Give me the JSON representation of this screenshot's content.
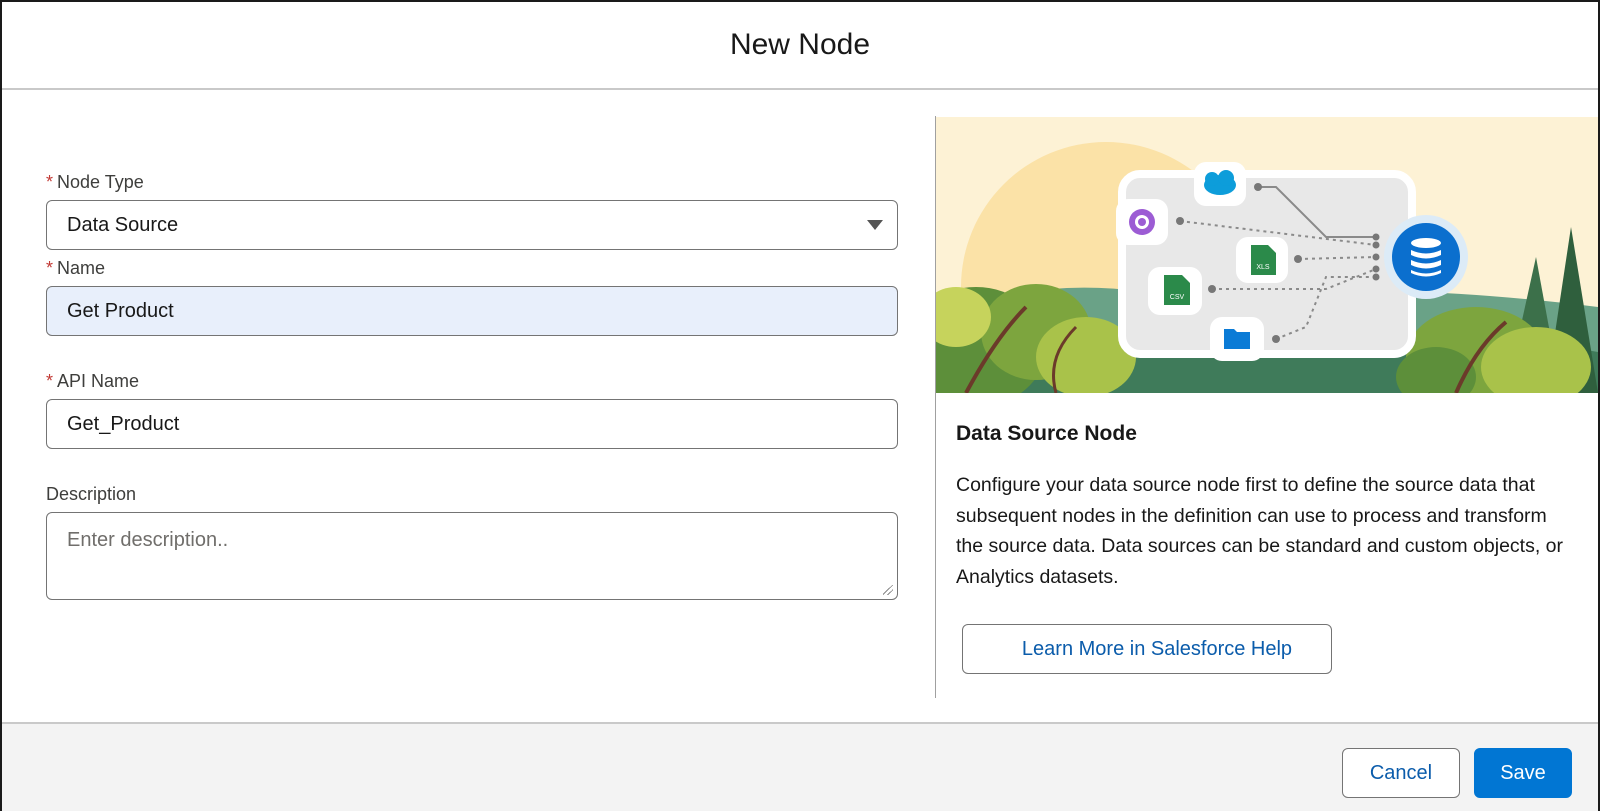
{
  "modal": {
    "title": "New Node"
  },
  "form": {
    "node_type": {
      "required_marker": "*",
      "label": "Node Type",
      "value": "Data Source"
    },
    "name": {
      "required_marker": "*",
      "label": "Name",
      "value": "Get Product"
    },
    "api_name": {
      "required_marker": "*",
      "label": "API Name",
      "value": "Get_Product"
    },
    "description": {
      "label": "Description",
      "placeholder": "Enter description.."
    }
  },
  "panel": {
    "title": "Data Source Node",
    "text": "Configure your data source node first to define the source data that subsequent nodes in the definition can use to process and transform the source data. Data sources can be standard and custom objects, or Analytics datasets.",
    "help_button": "Learn More in Salesforce Help",
    "illustration": {
      "file_labels": {
        "xls": "XLS",
        "csv": "CSV"
      },
      "icons": [
        "salesforce-cloud-icon",
        "community-icon",
        "xls-file-icon",
        "csv-file-icon",
        "folder-icon",
        "database-icon"
      ]
    }
  },
  "footer": {
    "cancel_label": "Cancel",
    "save_label": "Save"
  },
  "colors": {
    "brand": "#0176d3",
    "link": "#0b5cab",
    "required": "#c23934",
    "focused_field_bg": "#e8effb"
  }
}
